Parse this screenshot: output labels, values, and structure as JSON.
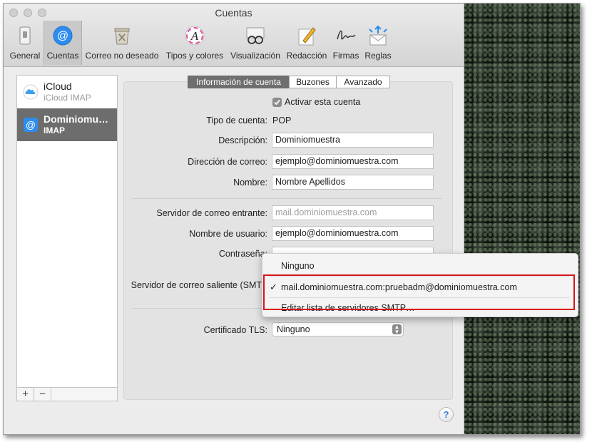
{
  "window": {
    "title": "Cuentas"
  },
  "toolbar": {
    "items": [
      {
        "label": "General",
        "icon": "switch-icon"
      },
      {
        "label": "Cuentas",
        "icon": "at-sign-icon"
      },
      {
        "label": "Correo no deseado",
        "icon": "junk-bin-icon"
      },
      {
        "label": "Tipos y colores",
        "icon": "font-a-icon"
      },
      {
        "label": "Visualización",
        "icon": "glasses-icon"
      },
      {
        "label": "Redacción",
        "icon": "pencil-icon"
      },
      {
        "label": "Firmas",
        "icon": "signature-icon"
      },
      {
        "label": "Reglas",
        "icon": "rules-envelope-icon"
      }
    ],
    "selected": "Cuentas"
  },
  "sidebar": {
    "accounts": [
      {
        "name": "iCloud",
        "type": "iCloud IMAP",
        "icon": "cloud-icon"
      },
      {
        "name": "Dominiomu…",
        "type": "IMAP",
        "icon": "at-sign-icon"
      }
    ],
    "add_label": "+",
    "remove_label": "−"
  },
  "tabs": [
    {
      "label": "Información de cuenta",
      "active": true
    },
    {
      "label": "Buzones",
      "active": false
    },
    {
      "label": "Avanzado",
      "active": false
    }
  ],
  "form": {
    "enable_label": "Activar esta cuenta",
    "enable_checked": true,
    "account_type_label": "Tipo de cuenta:",
    "account_type_value": "POP",
    "description_label": "Descripción:",
    "description_value": "Dominiomuestra",
    "email_label": "Dirección de correo:",
    "email_value": "ejemplo@dominiomuestra.com",
    "name_label": "Nombre:",
    "name_value": "Nombre Apellidos",
    "incoming_label": "Servidor de correo entrante:",
    "incoming_value": "mail.dominiomuestra.com",
    "username_label": "Nombre de usuario:",
    "username_value": "ejemplo@dominiomuestra.com",
    "password_label": "Contraseña:",
    "smtp_label": "Servidor de correo saliente (SMTP):",
    "tls_label": "Certificado TLS:",
    "tls_value": "Ninguno"
  },
  "smtp_menu": {
    "items": [
      {
        "label": "Ninguno",
        "checked": false
      },
      {
        "label": "mail.dominiomuestra.com:pruebadm@dominiomuestra.com",
        "checked": true
      },
      {
        "label": "Editar lista de servidores SMTP…",
        "checked": false
      }
    ],
    "check_mark": "✓"
  },
  "help": {
    "label": "?"
  },
  "colors": {
    "highlight": "#d8141b",
    "selected_row": "#6d6d6d",
    "accent": "#2d8cf0"
  }
}
